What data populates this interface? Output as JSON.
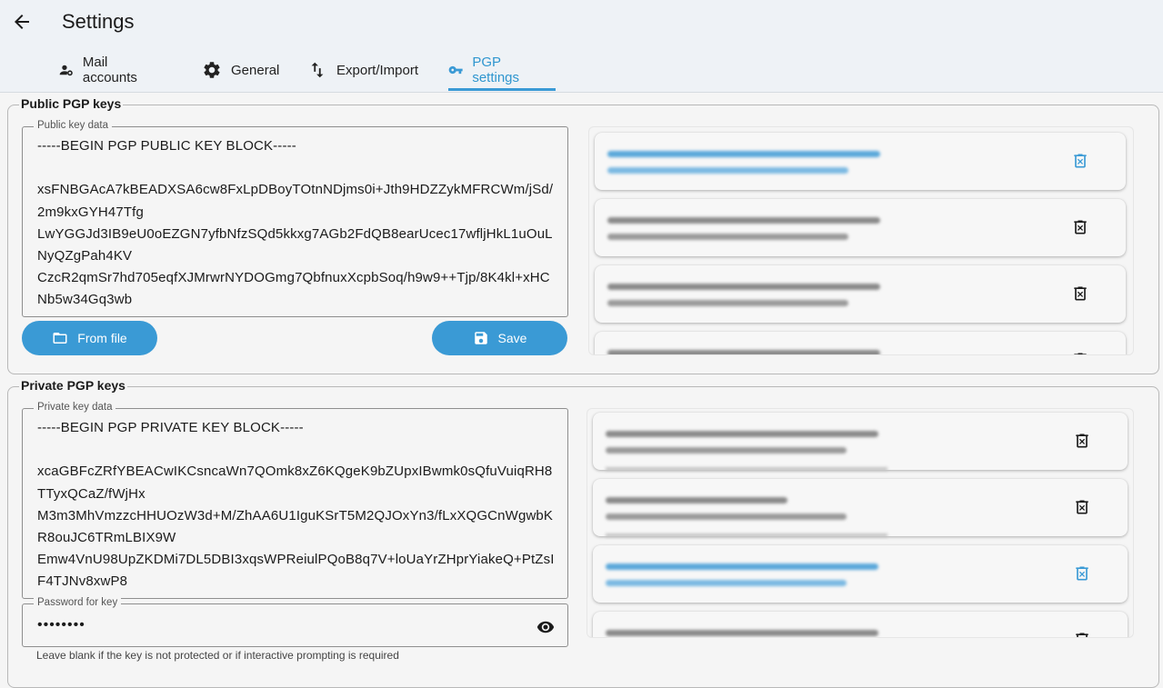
{
  "header": {
    "title": "Settings"
  },
  "tabs": [
    {
      "label": "Mail accounts"
    },
    {
      "label": "General"
    },
    {
      "label": "Export/Import"
    },
    {
      "label": "PGP settings"
    }
  ],
  "public": {
    "legend": "Public PGP keys",
    "field_label": "Public key data",
    "key_text": "-----BEGIN PGP PUBLIC KEY BLOCK-----\n\nxsFNBGAcA7kBEADXSA6cw8FxLpDBoyTOtnNDjms0i+Jth9HDZZykMFRCWm/jSd/2m9kxGYH47Tfg\nLwYGGJd3IB9eU0oEZGN7yfbNfzSQd5kkxg7AGb2FdQB8earUcec17wfljHkL1uOuLNyQZgPah4KV\nCzcR2qmSr7hd705eqfXJMrwrNYDOGmg7QbfnuxXcpbSoq/h9w9++Tjp/8K4kl+xHCNb5w34Gq3wb",
    "from_file_label": "From file",
    "save_label": "Save"
  },
  "private": {
    "legend": "Private PGP keys",
    "field_label": "Private key data",
    "key_text": "-----BEGIN PGP PRIVATE KEY BLOCK-----\n\nxcaGBFcZRfYBEACwIKCsncaWn7QOmk8xZ6KQgeK9bZUpxIBwmk0sQfuVuiqRH8TTyxQCaZ/fWjHx\nM3m3MhVmzzcHHUOzW3d+M/ZhAA6U1IguKSrT5M2QJOxYn3/fLxXQGCnWgwbKR8ouJC6TRmLBIX9W\nEmw4VnU98UpZKDMi7DL5DBI3xqsWPReiulPQoB8q7V+loUaYrZHprYiakeQ+PtZsIF4TJNv8xwP8",
    "password_label": "Password for key",
    "password_value": "••••••••",
    "hint": "Leave blank if the key is not protected or if interactive prompting is required"
  },
  "colors": {
    "accent": "#3a9ad5",
    "accent_text": "#2f96cf"
  }
}
